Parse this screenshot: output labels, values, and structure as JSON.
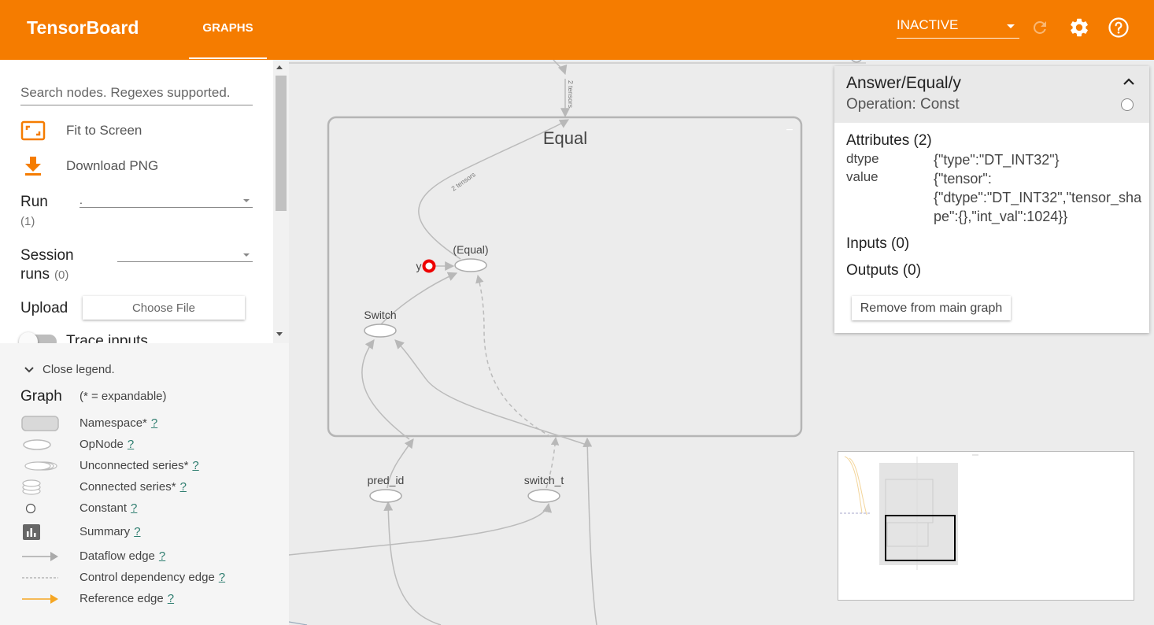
{
  "header": {
    "brand": "TensorBoard",
    "tab_graphs": "GRAPHS",
    "run_status": "INACTIVE",
    "colors": {
      "accent": "#f57c00",
      "text": "#ffffff"
    },
    "icons": [
      "reload-icon",
      "settings-icon",
      "help-icon"
    ]
  },
  "sidebar": {
    "search_placeholder": "Search nodes. Regexes supported.",
    "fit_to_screen": "Fit to Screen",
    "download_png": "Download PNG",
    "run_label": "Run",
    "run_count": "(1)",
    "run_value": ".",
    "session_label_1": "Session",
    "session_label_2": "runs",
    "session_count": "(0)",
    "session_value": "",
    "upload_label": "Upload",
    "choose_file": "Choose File",
    "trace_inputs": "Trace inputs"
  },
  "legend": {
    "toggle_label": "Close legend.",
    "title": "Graph",
    "subtitle": "(* = expandable)",
    "help_mark": "?",
    "items": [
      {
        "label": "Namespace*"
      },
      {
        "label": "OpNode"
      },
      {
        "label": "Unconnected series*"
      },
      {
        "label": "Connected series*"
      },
      {
        "label": "Constant"
      },
      {
        "label": "Summary"
      },
      {
        "label": "Dataflow edge"
      },
      {
        "label": "Control dependency edge"
      },
      {
        "label": "Reference edge"
      }
    ]
  },
  "graph": {
    "namespace_title": "Equal",
    "namespace_collapse": "−",
    "nodes": {
      "equal": "(Equal)",
      "switch": "Switch",
      "y": "y",
      "pred_id": "pred_id",
      "switch_t": "switch_t"
    },
    "edge_labels": {
      "top": "2 tensors",
      "inner": "2 tensors"
    }
  },
  "info_card": {
    "title": "Answer/Equal/y",
    "subtitle": "Operation: Const",
    "attributes_title": "Attributes (2)",
    "attributes": [
      {
        "key": "dtype",
        "value": "{\"type\":\"DT_INT32\"}"
      },
      {
        "key": "value",
        "value": "{\"tensor\":\n{\"dtype\":\"DT_INT32\",\"tensor_shape\":{},\"int_val\":1024}}"
      }
    ],
    "inputs_title": "Inputs (0)",
    "outputs_title": "Outputs (0)",
    "remove_button": "Remove from main graph"
  }
}
